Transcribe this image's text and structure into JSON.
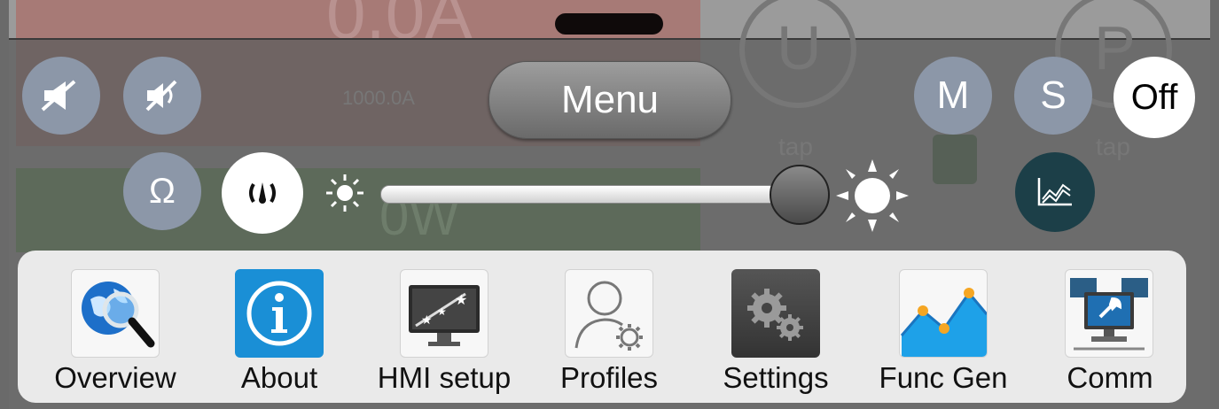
{
  "background": {
    "ghost_big_text": "0.0A",
    "ghost_current": "1000.0A",
    "ghost_power": "0W",
    "ghost_u": "U",
    "ghost_p": "P",
    "ghost_tap_left": "tap",
    "ghost_tap_right": "tap"
  },
  "toolbar": {
    "menu_label": "Menu",
    "mode_m": "M",
    "mode_s": "S",
    "off_label": "Off",
    "ohm_symbol": "Ω"
  },
  "brightness": {
    "level": 0.88
  },
  "apps": [
    {
      "label": "Overview",
      "icon": "globe-magnifier-icon"
    },
    {
      "label": "About",
      "icon": "info-icon"
    },
    {
      "label": "HMI setup",
      "icon": "display-stars-icon"
    },
    {
      "label": "Profiles",
      "icon": "user-gear-icon"
    },
    {
      "label": "Settings",
      "icon": "gears-icon"
    },
    {
      "label": "Func Gen",
      "icon": "line-graph-icon"
    },
    {
      "label": "Comm",
      "icon": "network-computers-icon"
    }
  ],
  "colors": {
    "button_gray_blue": "#8c97a8",
    "about_blue": "#1a8fd6",
    "graph_button": "#1c3f48"
  }
}
